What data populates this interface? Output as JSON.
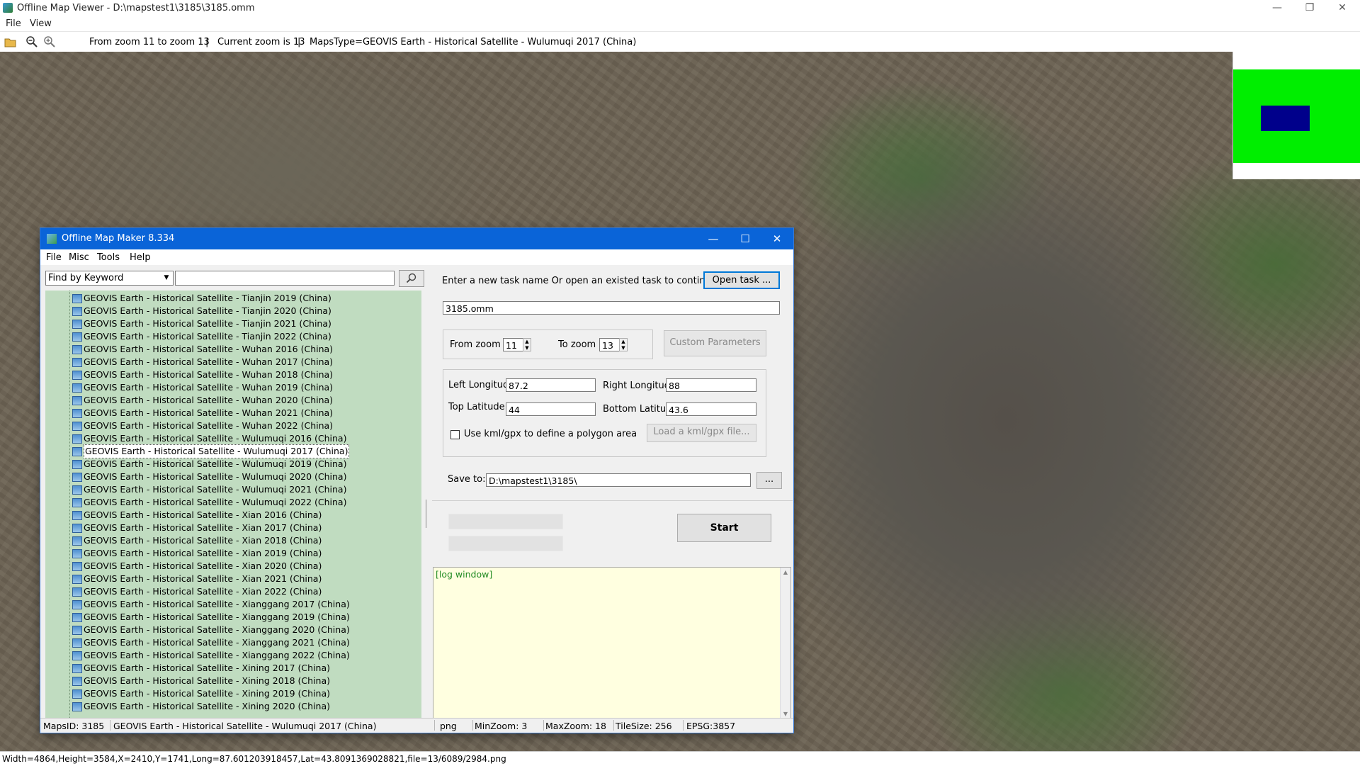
{
  "window": {
    "title": "Offline Map Viewer - D:\\mapstest1\\3185\\3185.omm",
    "menu": [
      "File",
      "View"
    ],
    "controls": {
      "minimize": "—",
      "restore": "❐",
      "close": "✕"
    }
  },
  "toolbar": {
    "zoom_range": "From zoom 11 to zoom 13",
    "separator1": "|",
    "current_zoom": "Current zoom is 13",
    "separator2": "|",
    "maps_type": "MapsType=GEOVIS Earth - Historical Satellite - Wulumuqi 2017 (China)"
  },
  "statusbar": {
    "text": "Width=4864,Height=3584,X=2410,Y=1741,Long=87.601203918457,Lat=43.8091369028821,file=13/6089/2984.png"
  },
  "dialog": {
    "title": "Offline Map Maker 8.334",
    "menu": [
      "File",
      "Misc",
      "Tools",
      "Help"
    ],
    "find": {
      "mode": "Find by Keyword",
      "value": "",
      "button_icon": "search-icon"
    },
    "list": {
      "items": [
        "GEOVIS Earth - Historical Satellite - Tianjin 2019 (China)",
        "GEOVIS Earth - Historical Satellite - Tianjin 2020 (China)",
        "GEOVIS Earth - Historical Satellite - Tianjin 2021 (China)",
        "GEOVIS Earth - Historical Satellite - Tianjin 2022 (China)",
        "GEOVIS Earth - Historical Satellite - Wuhan 2016 (China)",
        "GEOVIS Earth - Historical Satellite - Wuhan 2017 (China)",
        "GEOVIS Earth - Historical Satellite - Wuhan 2018 (China)",
        "GEOVIS Earth - Historical Satellite - Wuhan 2019 (China)",
        "GEOVIS Earth - Historical Satellite - Wuhan 2020 (China)",
        "GEOVIS Earth - Historical Satellite - Wuhan 2021 (China)",
        "GEOVIS Earth - Historical Satellite - Wuhan 2022 (China)",
        "GEOVIS Earth - Historical Satellite - Wulumuqi 2016 (China)",
        "GEOVIS Earth - Historical Satellite - Wulumuqi 2017 (China)",
        "GEOVIS Earth - Historical Satellite - Wulumuqi 2019 (China)",
        "GEOVIS Earth - Historical Satellite - Wulumuqi 2020 (China)",
        "GEOVIS Earth - Historical Satellite - Wulumuqi 2021 (China)",
        "GEOVIS Earth - Historical Satellite - Wulumuqi 2022 (China)",
        "GEOVIS Earth - Historical Satellite - Xian 2016 (China)",
        "GEOVIS Earth - Historical Satellite - Xian 2017 (China)",
        "GEOVIS Earth - Historical Satellite - Xian 2018 (China)",
        "GEOVIS Earth - Historical Satellite - Xian 2019 (China)",
        "GEOVIS Earth - Historical Satellite - Xian 2020 (China)",
        "GEOVIS Earth - Historical Satellite - Xian 2021 (China)",
        "GEOVIS Earth - Historical Satellite - Xian 2022 (China)",
        "GEOVIS Earth - Historical Satellite - Xianggang 2017 (China)",
        "GEOVIS Earth - Historical Satellite - Xianggang 2019 (China)",
        "GEOVIS Earth - Historical Satellite - Xianggang 2020 (China)",
        "GEOVIS Earth - Historical Satellite - Xianggang 2021 (China)",
        "GEOVIS Earth - Historical Satellite - Xianggang 2022 (China)",
        "GEOVIS Earth - Historical Satellite - Xining 2017 (China)",
        "GEOVIS Earth - Historical Satellite - Xining 2018 (China)",
        "GEOVIS Earth - Historical Satellite - Xining 2019 (China)",
        "GEOVIS Earth - Historical Satellite - Xining 2020 (China)"
      ],
      "selected_index": 12
    },
    "task": {
      "prompt": "Enter a new task name Or open an existed task to continue:",
      "open_button": "Open task ...",
      "name": "3185.omm"
    },
    "zoom": {
      "from_label": "From zoom",
      "from_value": "11",
      "to_label": "To zoom",
      "to_value": "13",
      "custom_button": "Custom Parameters"
    },
    "area": {
      "left_lon_label": "Left Longitude",
      "left_lon": "87.2",
      "right_lon_label": "Right Longitude",
      "right_lon": "88",
      "top_lat_label": "Top Latitude",
      "top_lat": "44",
      "bottom_lat_label": "Bottom Latitude",
      "bottom_lat": "43.6",
      "kml_checkbox_label": "Use kml/gpx to define a polygon area",
      "kml_checked": false,
      "load_kml_button": "Load a kml/gpx file..."
    },
    "save": {
      "label": "Save to:",
      "path": "D:\\mapstest1\\3185\\",
      "browse_button": "..."
    },
    "start_button": "Start",
    "log_text": "[log window]",
    "status": {
      "maps_id": "MapsID: 3185",
      "maps_name": "GEOVIS Earth - Historical Satellite - Wulumuqi 2017 (China)",
      "format": "png",
      "min_zoom": "MinZoom: 3",
      "max_zoom": "MaxZoom: 18",
      "tile_size": "TileSize: 256",
      "epsg": "EPSG:3857"
    }
  },
  "colors": {
    "dialog_titlebar": "#0a64d8",
    "list_background": "#c0dcc0",
    "log_background": "#ffffe0",
    "log_text": "#228b22",
    "minimap_bg": "#00ee00",
    "minimap_view": "#00008b"
  }
}
